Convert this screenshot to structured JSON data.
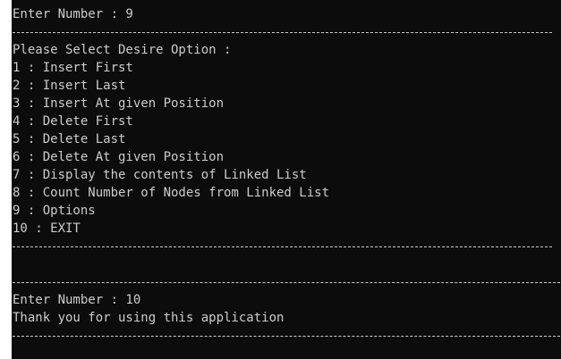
{
  "console": {
    "prompt1": "Enter Number : 9",
    "menu_title": "Please Select Desire Option :",
    "menu_items": [
      "1 : Insert First",
      "2 : Insert Last",
      "3 : Insert At given Position",
      "4 : Delete First",
      "5 : Delete Last",
      "6 : Delete At given Position",
      "7 : Display the contents of Linked List",
      "8 : Count Number of Nodes from Linked List",
      "9 : Options",
      "10 : EXIT"
    ],
    "prompt2": "Enter Number : 10",
    "farewell": "Thank you for using this application"
  }
}
